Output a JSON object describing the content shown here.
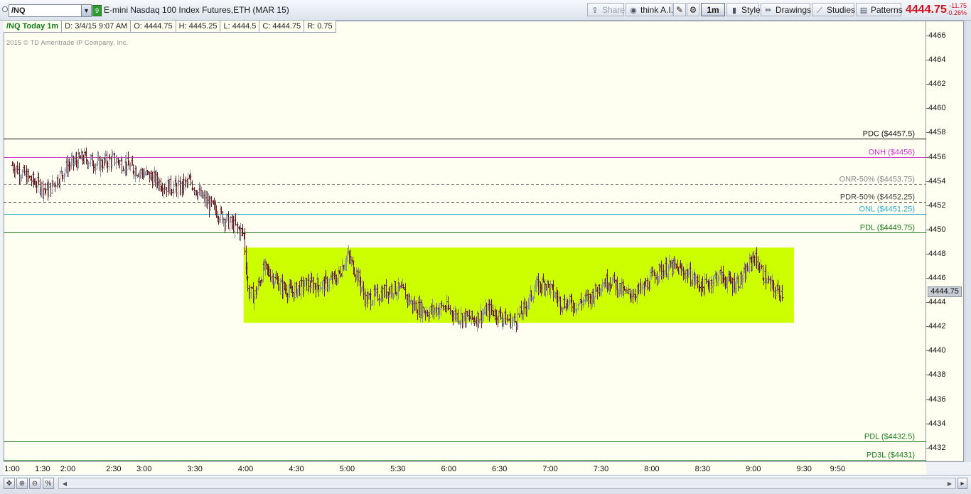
{
  "toolbar": {
    "symbol": "/NQ",
    "link_badge": "9",
    "instrument": "E-mini Nasdaq 100 Index Futures,ETH (MAR 15)",
    "share_label": "Share",
    "think_ai_label": "think A.I.",
    "timeframe_label": "1m",
    "style_label": "Style",
    "drawings_label": "Drawings",
    "studies_label": "Studies",
    "patterns_label": "Patterns",
    "last_price": "4444.75",
    "net_change": "-11.75",
    "pct_change": "-0.26%"
  },
  "info_bar": {
    "study": "/NQ Today 1m",
    "date": "D: 3/4/15 9:07 AM",
    "open": "O: 4444.75",
    "high": "H: 4445.25",
    "low": "L: 4444.5",
    "close": "C: 4444.75",
    "range": "R: 0.75"
  },
  "copyright": "2015 © TD Ameritrade IP Company, Inc.",
  "price_tag": "4444.75",
  "colors": {
    "background": "#fefff1",
    "up_bar": "#8a93a6",
    "down_bar": "#6b1a1a",
    "consolidation_zone": "#ccff00",
    "onh": "#cc33cc",
    "onl": "#33aacc",
    "pdl": "#1e7a1e",
    "pdc": "#111111",
    "mid": "#777777"
  },
  "chart_data": {
    "type": "candlestick",
    "title": "",
    "xlabel": "",
    "ylabel": "",
    "ylim": [
      4430.5,
      4467.2
    ],
    "y_ticks": [
      4432,
      4434,
      4436,
      4438,
      4440,
      4442,
      4444,
      4446,
      4448,
      4450,
      4452,
      4454,
      4456,
      4458,
      4460,
      4462,
      4464,
      4466
    ],
    "x_ticks": [
      {
        "label": "1:00",
        "t": 0
      },
      {
        "label": "1:30",
        "t": 30
      },
      {
        "label": "2:00",
        "t": 55
      },
      {
        "label": "2:30",
        "t": 100
      },
      {
        "label": "3:00",
        "t": 130
      },
      {
        "label": "3:30",
        "t": 180
      },
      {
        "label": "4:00",
        "t": 230
      },
      {
        "label": "4:30",
        "t": 280
      },
      {
        "label": "5:00",
        "t": 330
      },
      {
        "label": "5:30",
        "t": 380
      },
      {
        "label": "6:00",
        "t": 430
      },
      {
        "label": "6:30",
        "t": 480
      },
      {
        "label": "7:00",
        "t": 530
      },
      {
        "label": "7:30",
        "t": 580
      },
      {
        "label": "8:00",
        "t": 630
      },
      {
        "label": "8:30",
        "t": 680
      },
      {
        "label": "9:00",
        "t": 730
      },
      {
        "label": "9:30",
        "t": 780
      },
      {
        "label": "9:50",
        "t": 813
      }
    ],
    "levels": [
      {
        "label": "PDC ($4457.5)",
        "value": 4457.5,
        "color": "#111111",
        "style": "solid"
      },
      {
        "label": "ONH ($4456)",
        "value": 4456,
        "color": "#cc33cc",
        "style": "solid"
      },
      {
        "label": "ONR-50% ($4453.75)",
        "value": 4453.75,
        "color": "#888888",
        "style": "dashed"
      },
      {
        "label": "PDR-50% ($4452.25)",
        "value": 4452.25,
        "color": "#444444",
        "style": "dashed"
      },
      {
        "label": "ONL ($4451.25)",
        "value": 4451.25,
        "color": "#33aacc",
        "style": "solid"
      },
      {
        "label": "PDL ($4449.75)",
        "value": 4449.75,
        "color": "#1e7a1e",
        "style": "solid"
      },
      {
        "label": "PDL ($4432.5)",
        "value": 4432.5,
        "color": "#1e7a1e",
        "style": "solid"
      },
      {
        "label": "PD3L ($4431)",
        "value": 4431,
        "color": "#1e7a1e",
        "style": "solid"
      }
    ],
    "zone": {
      "t_start": 228,
      "t_end": 770,
      "low": 4442.3,
      "high": 4448.5
    },
    "price_path": [
      [
        0,
        4455.3
      ],
      [
        10,
        4454.6
      ],
      [
        20,
        4454.0
      ],
      [
        35,
        4453.2
      ],
      [
        45,
        4454.2
      ],
      [
        55,
        4455.3
      ],
      [
        70,
        4455.9
      ],
      [
        85,
        4455.4
      ],
      [
        100,
        4455.8
      ],
      [
        120,
        4455.0
      ],
      [
        135,
        4454.4
      ],
      [
        150,
        4453.6
      ],
      [
        165,
        4453.4
      ],
      [
        175,
        4454.0
      ],
      [
        185,
        4452.8
      ],
      [
        200,
        4451.6
      ],
      [
        210,
        4450.8
      ],
      [
        220,
        4450.2
      ],
      [
        228,
        4449.6
      ],
      [
        232,
        4445.0
      ],
      [
        238,
        4444.4
      ],
      [
        248,
        4446.8
      ],
      [
        255,
        4446.2
      ],
      [
        265,
        4445.3
      ],
      [
        275,
        4444.8
      ],
      [
        290,
        4445.5
      ],
      [
        305,
        4445.4
      ],
      [
        320,
        4446.0
      ],
      [
        330,
        4447.9
      ],
      [
        340,
        4446.2
      ],
      [
        348,
        4444.2
      ],
      [
        360,
        4444.6
      ],
      [
        375,
        4445.2
      ],
      [
        385,
        4444.8
      ],
      [
        395,
        4443.7
      ],
      [
        410,
        4443.2
      ],
      [
        425,
        4443.6
      ],
      [
        440,
        4442.8
      ],
      [
        455,
        4442.6
      ],
      [
        470,
        4443.4
      ],
      [
        485,
        4442.6
      ],
      [
        495,
        4442.4
      ],
      [
        505,
        4443.6
      ],
      [
        515,
        4445.2
      ],
      [
        525,
        4445.6
      ],
      [
        540,
        4444.0
      ],
      [
        555,
        4443.8
      ],
      [
        570,
        4444.4
      ],
      [
        580,
        4445.6
      ],
      [
        590,
        4445.8
      ],
      [
        605,
        4444.6
      ],
      [
        620,
        4445.0
      ],
      [
        635,
        4446.5
      ],
      [
        650,
        4446.9
      ],
      [
        665,
        4446.4
      ],
      [
        680,
        4445.2
      ],
      [
        695,
        4446.2
      ],
      [
        710,
        4445.5
      ],
      [
        720,
        4446.0
      ],
      [
        730,
        4447.8
      ],
      [
        740,
        4446.2
      ],
      [
        750,
        4445.0
      ],
      [
        758,
        4444.8
      ]
    ]
  }
}
